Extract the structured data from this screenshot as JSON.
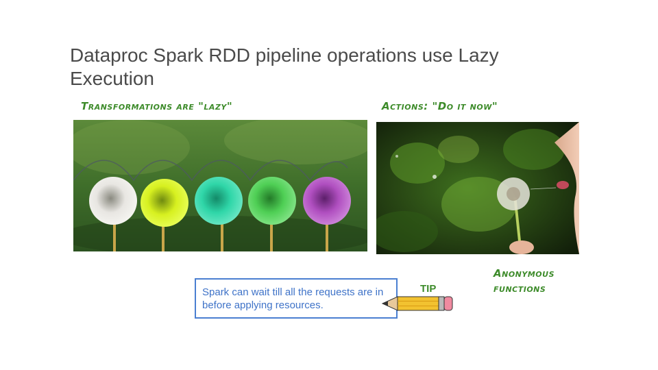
{
  "slide": {
    "title": "Dataproc Spark RDD pipeline operations use Lazy Execution"
  },
  "left_panel": {
    "label": "Transformations are \"lazy\"",
    "image_icon": "dandelions-in-a-row-image"
  },
  "right_panel": {
    "label": "Actions: \"Do it now\"",
    "image_icon": "blowing-dandelion-image"
  },
  "annotation": {
    "label": "Anonymous functions"
  },
  "tip": {
    "label": "TIP",
    "text": "Spark can wait till all the requests are in before applying resources.",
    "icon": "pencil-icon"
  },
  "colors": {
    "title": "#4a4a4a",
    "handwriting_green": "#3d8b2a",
    "tip_blue": "#4a7fd1",
    "dandelions": [
      "#e8e6e2",
      "#d7f020",
      "#2fd6a8",
      "#4fcf55",
      "#b04fc0"
    ]
  }
}
